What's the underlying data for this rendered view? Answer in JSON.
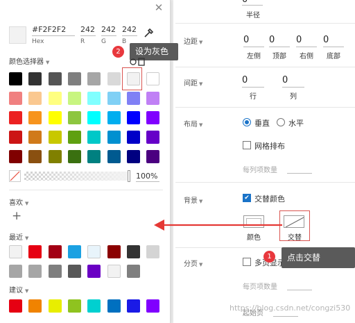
{
  "picker": {
    "hex_value": "#F2F2F2",
    "hex_label": "Hex",
    "rgb": [
      {
        "value": "242",
        "label": "R"
      },
      {
        "value": "242",
        "label": "G"
      },
      {
        "value": "242",
        "label": "B"
      }
    ],
    "section_selector": "颜色选择器",
    "opacity_value": "100%",
    "section_favorites": "喜欢",
    "add_symbol": "+",
    "section_recent": "最近",
    "section_suggest": "建议",
    "palette": [
      [
        "#000000",
        "#333333",
        "#555555",
        "#7f7f7f",
        "#a6a6a6",
        "#d9d9d9",
        "#f2f2f2",
        "#ffffff"
      ],
      [
        "#f08080",
        "#fac890",
        "#ffff80",
        "#c8f580",
        "#80ffff",
        "#80d0f5",
        "#8080f5",
        "#c080f5"
      ],
      [
        "#ec2121",
        "#f7941d",
        "#ffff00",
        "#8dc63f",
        "#00ffff",
        "#00aeef",
        "#0000ff",
        "#8000ff"
      ],
      [
        "#cc1515",
        "#d07a1a",
        "#c8c800",
        "#5fa010",
        "#00c8c8",
        "#0090d0",
        "#0000c8",
        "#6600c8"
      ],
      [
        "#800000",
        "#8a5010",
        "#808000",
        "#3a7010",
        "#008080",
        "#005a90",
        "#000080",
        "#4b0080"
      ]
    ],
    "recent_colors": [
      [
        "#f2f2f2",
        "#e60012",
        "#a30014",
        "#1ba1e2",
        "#e8f4fb",
        "#8b0000",
        "#333333",
        "#d4d4d4"
      ],
      [
        "#a6a6a6",
        "#a6a6a6",
        "#7f7f7f",
        "#595959",
        "#6a00c4",
        "#f2f2f2",
        "#7f7f7f"
      ]
    ],
    "suggest_colors": [
      "#e60012",
      "#f08300",
      "#e8ee00",
      "#8fc31f",
      "#00d0d0",
      "#0070c0",
      "#1a1ae6",
      "#8000ff"
    ]
  },
  "annotations": {
    "badge1": "1",
    "badge2": "2",
    "tip_gray": "设为灰色",
    "tip_alternate": "点击交替"
  },
  "props": {
    "radius_label": "半径",
    "radius_value": "0",
    "margin_label": "边距",
    "margins": [
      {
        "value": "0",
        "label": "左侧"
      },
      {
        "value": "0",
        "label": "顶部"
      },
      {
        "value": "0",
        "label": "右侧"
      },
      {
        "value": "0",
        "label": "底部"
      }
    ],
    "spacing_label": "间距",
    "spacings": [
      {
        "value": "0",
        "label": "行"
      },
      {
        "value": "0",
        "label": "列"
      }
    ],
    "layout_label": "布局",
    "layout_vertical": "垂直",
    "layout_horizontal": "水平",
    "grid_label": "网格排布",
    "per_row_label": "每列项数量",
    "bg_label": "背景",
    "alternate_label": "交替颜色",
    "color_label": "颜色",
    "alt_label": "交替",
    "pagination_label": "分页",
    "multipage_label": "多页显示",
    "per_page_label": "每页项数量",
    "start_page_label": "起始页"
  },
  "watermark": "https://blog.csdn.net/congzi530"
}
